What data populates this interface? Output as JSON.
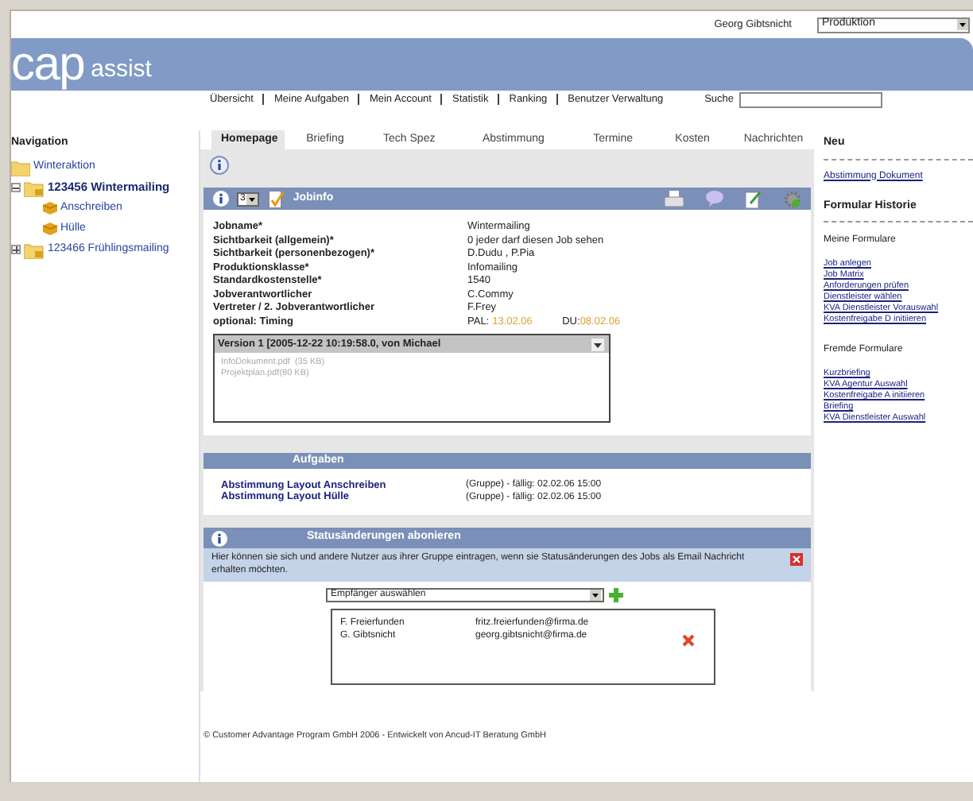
{
  "header": {
    "user": "Georg Gibtsnicht",
    "role_select": "Produktion",
    "logo_main": "cap",
    "logo_sub": "assist",
    "menu": [
      "Übersicht",
      "Meine Aufgaben",
      "Mein Account",
      "Statistik",
      "Ranking",
      "Benutzer Verwaltung"
    ],
    "search_label": "Suche"
  },
  "navigation": {
    "title": "Navigation",
    "tree": [
      {
        "label": "Winteraktion",
        "kind": "folder",
        "selected": false
      },
      {
        "label": "123456 Wintermailing",
        "kind": "project",
        "selected": true,
        "expanded": true,
        "children": [
          {
            "label": "Anschreiben",
            "kind": "item",
            "selected": false
          },
          {
            "label": "Hülle",
            "kind": "item",
            "selected": false
          }
        ]
      },
      {
        "label": "123466 Frühlingsmailing",
        "kind": "project",
        "selected": false,
        "expanded": false
      }
    ]
  },
  "tabs": [
    {
      "label": "Homepage",
      "selected": true
    },
    {
      "label": "Briefing",
      "selected": false
    },
    {
      "label": "Tech Spez",
      "selected": false
    },
    {
      "label": "Abstimmung",
      "selected": false
    },
    {
      "label": "Termine",
      "selected": false
    },
    {
      "label": "Kosten",
      "selected": false
    },
    {
      "label": "Nachrichten",
      "selected": false
    }
  ],
  "jobinfo": {
    "page_select": "3",
    "title": "Jobinfo",
    "fields": [
      {
        "label": "Jobname*",
        "value": "Wintermailing"
      },
      {
        "label": "Sichtbarkeit (allgemein)*",
        "value": "0 jeder darf diesen Job sehen"
      },
      {
        "label": "Sichtbarkeit (personenbezogen)*",
        "value": "D.Dudu , P.Pia"
      },
      {
        "label": "Produktionsklasse*",
        "value": "Infomailing"
      },
      {
        "label": "Standardkostenstelle*",
        "value": "1540"
      },
      {
        "label": "Jobverantwortlicher",
        "value": "C.Commy"
      },
      {
        "label": "Vertreter / 2. Jobverantwortlicher",
        "value": "F.Frey"
      }
    ],
    "timing": {
      "label": "optional: Timing",
      "pal_label": "PAL:",
      "pal_value": "13.02.06",
      "du_label": "DU:",
      "du_value": "08.02.06"
    },
    "version": {
      "title": "Version 1 [2005-12-22 10:19:58.0, von Michael",
      "files": [
        "InfoDokument.pdf  (35 KB)",
        "Projektplan.pdf(80 KB)"
      ]
    }
  },
  "tasks": {
    "title": "Aufgaben",
    "items": [
      {
        "title": "Abstimmung Layout Anschreiben",
        "info": "(Gruppe) - fällig: 02.02.06 15:00"
      },
      {
        "title": "Abstimmung Layout Hülle",
        "info": "(Gruppe) - fällig: 02.02.06 15:00"
      }
    ]
  },
  "subscriptions": {
    "title": "Statusänderungen abonieren",
    "description": "Hier können sie sich und andere Nutzer aus ihrer Gruppe eintragen, wenn sie Statusänderungen des Jobs als Email Nachricht erhalten möchten.",
    "recipient_select": "Empfänger auswählen",
    "recipients": [
      {
        "name": "F. Freierfunden",
        "email": "fritz.freierfunden@firma.de",
        "removable": false
      },
      {
        "name": "G. Gibtsnicht",
        "email": "georg.gibtsnicht@firma.de",
        "removable": true
      }
    ]
  },
  "footer": "© Customer Advantage Program GmbH 2006 - Entwickelt von Ancud-IT Beratung GmbH",
  "sidebar": {
    "new_title": "Neu",
    "new_links": [
      "Abstimmung Dokument"
    ],
    "history_title": "Formular Historie",
    "groups": [
      {
        "title": "Meine Formulare",
        "links": [
          "Job anlegen",
          "Job Matrix",
          "Anforderungen prüfen",
          "Dienstleister wählen",
          "KVA Dienstleister Vorauswahl",
          "Kostenfreigabe D initiieren"
        ]
      },
      {
        "title": "Fremde Formulare",
        "links": [
          "Kurzbriefing",
          "KVA Agentur Auswahl",
          "Kostenfreigabe A initiieren",
          "Briefing",
          "KVA Dienstleister Auswahl"
        ]
      }
    ]
  }
}
